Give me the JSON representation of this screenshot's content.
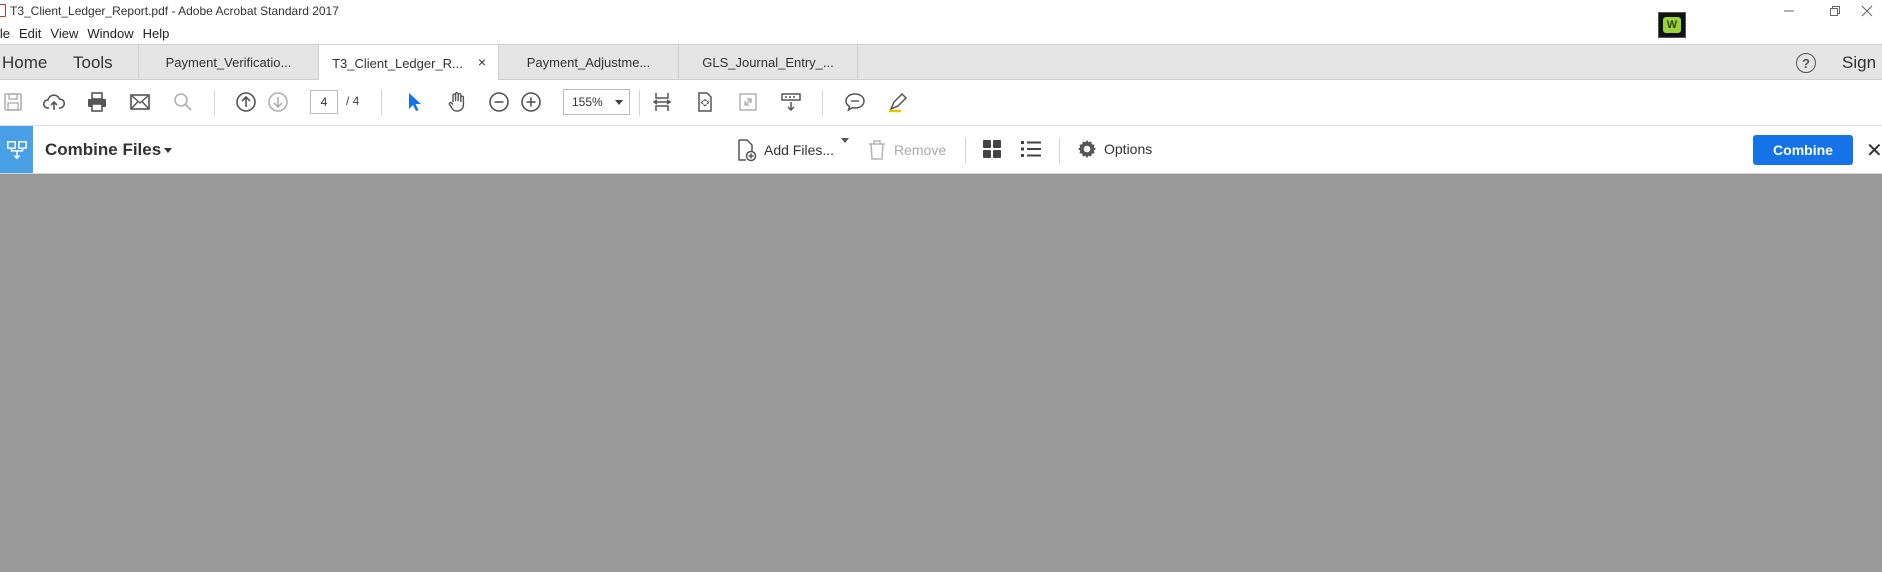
{
  "window": {
    "title": "T3_Client_Ledger_Report.pdf - Adobe Acrobat Standard 2017",
    "app_badge_letter": "W"
  },
  "menu": {
    "items": [
      "ile",
      "Edit",
      "View",
      "Window",
      "Help"
    ]
  },
  "tabs": {
    "home": "Home",
    "tools": "Tools",
    "documents": [
      {
        "label": "Payment_Verificatio...",
        "active": false
      },
      {
        "label": "T3_Client_Ledger_R...",
        "active": true,
        "close": "×"
      },
      {
        "label": "Payment_Adjustme...",
        "active": false
      },
      {
        "label": "GLS_Journal_Entry_...",
        "active": false
      }
    ],
    "help_symbol": "?",
    "sign": "Sign"
  },
  "toolbar": {
    "current_page": "4",
    "page_total": "/ 4",
    "zoom": "155%",
    "icons": [
      "save-icon",
      "upload-icon",
      "print-icon",
      "email-icon",
      "search-icon",
      "page-up-icon",
      "page-down-icon",
      "select-arrow-icon",
      "hand-icon",
      "zoom-out-icon",
      "zoom-in-icon",
      "fit-width-icon",
      "fit-page-icon",
      "full-screen-icon",
      "scroll-mode-icon",
      "comment-icon",
      "highlight-pen-icon"
    ]
  },
  "combine": {
    "title": "Combine Files",
    "add_files": "Add Files...",
    "remove": "Remove",
    "options": "Options",
    "combine_button": "Combine",
    "close_symbol": "✕"
  },
  "colors": {
    "accent_blue": "#1473e6",
    "tool_icon_blue": "#4aa0e6",
    "document_background": "#999999",
    "tab_bar": "#e5e5e5"
  }
}
